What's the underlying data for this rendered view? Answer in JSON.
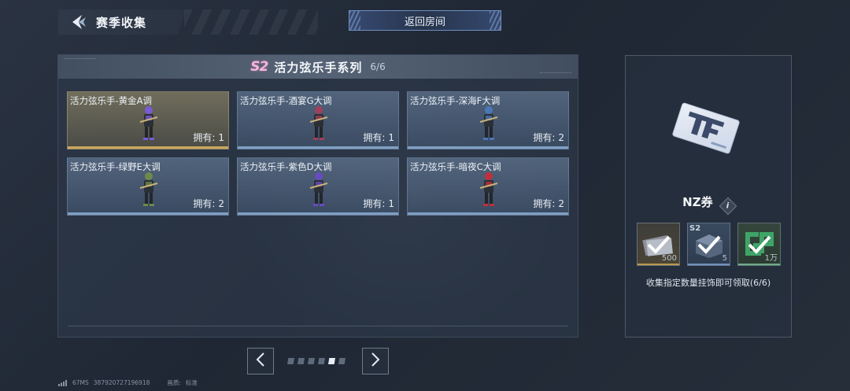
{
  "header": {
    "title": "赛季收集",
    "return_label": "返回房间"
  },
  "series": {
    "badge": "S2",
    "title": "活力弦乐手系列",
    "count": "6/6"
  },
  "cards": [
    {
      "name": "活力弦乐手-黄金A调",
      "own_label": "拥有:",
      "own_count": "1",
      "variant": "gold",
      "accent": "#7a5bd6"
    },
    {
      "name": "活力弦乐手-酒宴G大调",
      "own_label": "拥有:",
      "own_count": "1",
      "variant": "blue",
      "accent": "#a0405a"
    },
    {
      "name": "活力弦乐手-深海F大调",
      "own_label": "拥有:",
      "own_count": "2",
      "variant": "blue",
      "accent": "#4a78b8"
    },
    {
      "name": "活力弦乐手-绿野E大调",
      "own_label": "拥有:",
      "own_count": "2",
      "variant": "blue",
      "accent": "#6e8a4a"
    },
    {
      "name": "活力弦乐手-紫色D大调",
      "own_label": "拥有:",
      "own_count": "1",
      "variant": "blue",
      "accent": "#6a4ac0"
    },
    {
      "name": "活力弦乐手-暗夜C大调",
      "own_label": "拥有:",
      "own_count": "2",
      "variant": "blue",
      "accent": "#c0303c"
    }
  ],
  "pagination": {
    "prev_icon": "chevron-left-icon",
    "next_icon": "chevron-right-icon",
    "total_pages": 6,
    "current_page": 5
  },
  "footer": {
    "ping": "67MS",
    "player_id": "387920727196918",
    "quality_label": "画质:",
    "quality_value": "标准"
  },
  "reward": {
    "name": "NZ券",
    "info_icon": "info-icon",
    "tiers": [
      {
        "tag": "",
        "amount": "500",
        "claimed": true
      },
      {
        "tag": "S2",
        "amount": "5",
        "claimed": true
      },
      {
        "tag": "",
        "amount": "1万",
        "claimed": true
      }
    ],
    "description": "收集指定数量挂饰即可领取(6/6)"
  }
}
